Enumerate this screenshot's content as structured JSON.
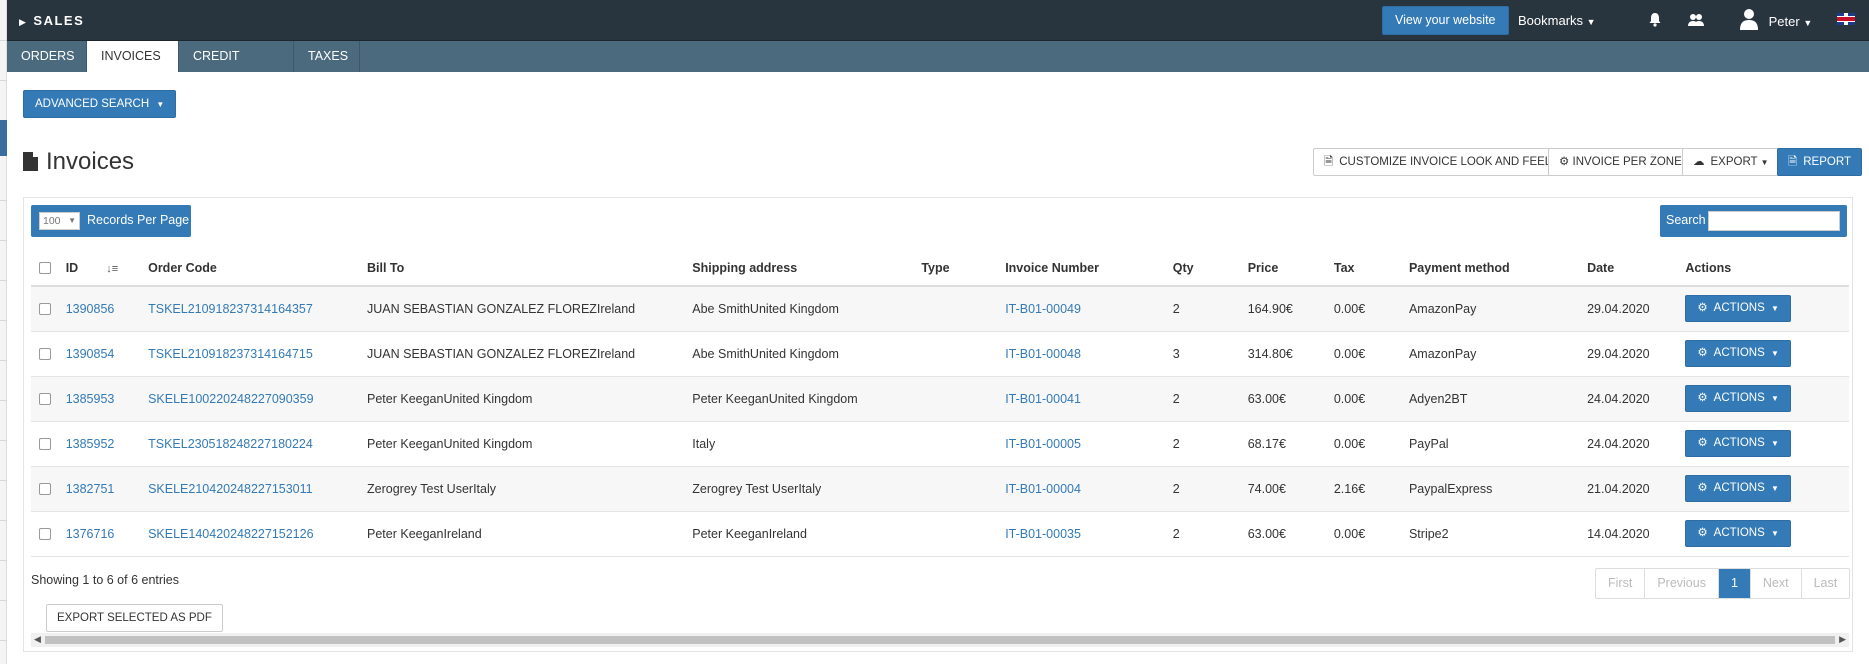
{
  "topbar": {
    "title": "SALES",
    "view_website": "View your website",
    "bookmarks": "Bookmarks",
    "user": "Peter",
    "icons": [
      "bell-icon",
      "users-icon",
      "user-icon",
      "uk-flag-icon"
    ]
  },
  "tabs": [
    {
      "label": "ORDERS"
    },
    {
      "label": "INVOICES",
      "active": true
    },
    {
      "label": "CREDIT NOTES"
    },
    {
      "label": "TAXES"
    }
  ],
  "advanced_search": "ADVANCED SEARCH",
  "page": {
    "title": "Invoices",
    "buttons": {
      "customize": "CUSTOMIZE INVOICE LOOK AND FEEL",
      "per_zone": "INVOICE PER ZONE",
      "export": "EXPORT",
      "report": "REPORT"
    }
  },
  "controls": {
    "records_value": "100",
    "records_label": "Records Per Page",
    "search_label": "Search",
    "search_value": ""
  },
  "table": {
    "columns": [
      "ID",
      "Order Code",
      "Bill To",
      "Shipping address",
      "Type",
      "Invoice Number",
      "Qty",
      "Price",
      "Tax",
      "Payment method",
      "Date",
      "Actions"
    ],
    "rows": [
      {
        "id": "1390856",
        "order_code": "TSKEL210918237314164357",
        "bill_to": "JUAN SEBASTIAN GONZALEZ FLOREZIreland",
        "shipping": "Abe SmithUnited Kingdom",
        "type": "",
        "invoice": "IT-B01-00049",
        "qty": "2",
        "price": "164.90€",
        "tax": "0.00€",
        "payment": "AmazonPay",
        "date": "29.04.2020",
        "action": "ACTIONS"
      },
      {
        "id": "1390854",
        "order_code": "TSKEL210918237314164715",
        "bill_to": "JUAN SEBASTIAN GONZALEZ FLOREZIreland",
        "shipping": "Abe SmithUnited Kingdom",
        "type": "",
        "invoice": "IT-B01-00048",
        "qty": "3",
        "price": "314.80€",
        "tax": "0.00€",
        "payment": "AmazonPay",
        "date": "29.04.2020",
        "action": "ACTIONS"
      },
      {
        "id": "1385953",
        "order_code": "SKELE100220248227090359",
        "bill_to": "Peter KeeganUnited Kingdom",
        "shipping": "Peter KeeganUnited Kingdom",
        "type": "",
        "invoice": "IT-B01-00041",
        "qty": "2",
        "price": "63.00€",
        "tax": "0.00€",
        "payment": "Adyen2BT",
        "date": "24.04.2020",
        "action": "ACTIONS"
      },
      {
        "id": "1385952",
        "order_code": "TSKEL230518248227180224",
        "bill_to": "Peter KeeganUnited Kingdom",
        "shipping": "Italy",
        "type": "",
        "invoice": "IT-B01-00005",
        "qty": "2",
        "price": "68.17€",
        "tax": "0.00€",
        "payment": "PayPal",
        "date": "24.04.2020",
        "action": "ACTIONS"
      },
      {
        "id": "1382751",
        "order_code": "SKELE210420248227153011",
        "bill_to": "Zerogrey Test UserItaly",
        "shipping": "Zerogrey Test UserItaly",
        "type": "",
        "invoice": "IT-B01-00004",
        "qty": "2",
        "price": "74.00€",
        "tax": "2.16€",
        "payment": "PaypalExpress",
        "date": "21.04.2020",
        "action": "ACTIONS"
      },
      {
        "id": "1376716",
        "order_code": "SKELE140420248227152126",
        "bill_to": "Peter KeeganIreland",
        "shipping": "Peter KeeganIreland",
        "type": "",
        "invoice": "IT-B01-00035",
        "qty": "2",
        "price": "63.00€",
        "tax": "0.00€",
        "payment": "Stripe2",
        "date": "14.04.2020",
        "action": "ACTIONS"
      }
    ]
  },
  "footer": {
    "info": "Showing 1 to 6 of 6 entries",
    "export_pdf": "EXPORT SELECTED AS PDF",
    "pagination": [
      "First",
      "Previous",
      "1",
      "Next",
      "Last"
    ],
    "current_page": "1"
  },
  "colors": {
    "topbar": "#28353e",
    "tabbar": "#4c6a7e",
    "primary": "#337ab7",
    "link": "#337ab7"
  }
}
